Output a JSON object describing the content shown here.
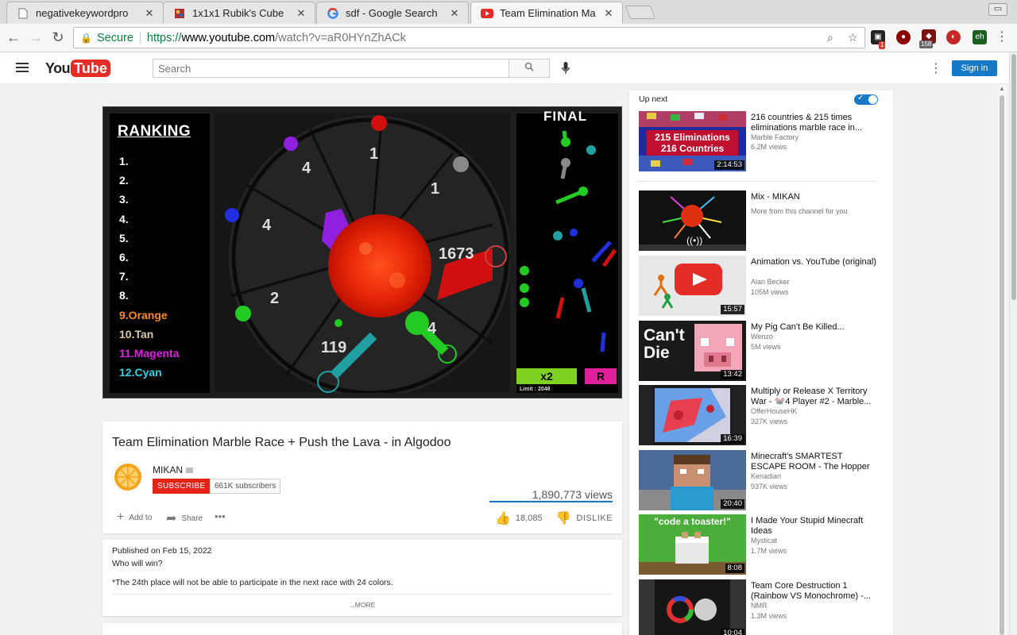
{
  "browser": {
    "tabs": [
      {
        "title": "negativekeywordpro",
        "favicon": "document-icon"
      },
      {
        "title": "1x1x1 Rubik's Cube",
        "favicon": "cube-icon"
      },
      {
        "title": "sdf - Google Search",
        "favicon": "google-icon"
      },
      {
        "title": "Team Elimination Ma",
        "favicon": "youtube-icon"
      }
    ],
    "address": {
      "secure_label": "Secure",
      "protocol": "https://",
      "host": "www.youtube.com",
      "path": "/watch?v=aR0HYnZhACk"
    },
    "extensions": {
      "badge_red": "1",
      "badge_count": "158"
    }
  },
  "youtube": {
    "logo_you": "You",
    "logo_tube": "Tube",
    "search_placeholder": "Search",
    "sign_in": "Sign in"
  },
  "video": {
    "overlay": {
      "ranking_title": "RANKING",
      "ranks": [
        "1.",
        "2.",
        "3.",
        "4.",
        "5.",
        "6.",
        "7.",
        "8.",
        "9.Orange",
        "10.Tan",
        "11.Magenta",
        "12.Cyan"
      ],
      "rank_colors": [
        "#ffffff",
        "#ffffff",
        "#ffffff",
        "#ffffff",
        "#ffffff",
        "#ffffff",
        "#ffffff",
        "#ffffff",
        "#ff8c1a",
        "#d9c8a8",
        "#e020e0",
        "#30d0e0"
      ],
      "arena_numbers": [
        "4",
        "1",
        "1",
        "4",
        "1673",
        "2",
        "119",
        "4"
      ],
      "final_title": "FINAL",
      "multiplier": "x2",
      "r_label": "R",
      "limit": "Limit : 2048"
    },
    "title": "Team Elimination Marble Race + Push the Lava - in Algodoo",
    "channel": "MIKAN",
    "subscribe": "SUBSCRIBE",
    "subscribers": "661K subscribers",
    "views": "1,890,773 views",
    "actions": {
      "add_to": "Add to",
      "share": "Share",
      "likes": "18,085",
      "dislike": "DISLIKE"
    },
    "description": {
      "published": "Published on Feb 15, 2022",
      "line1": "Who will win?",
      "line2": "*The 24th place will not be able to participate in the next race with 24 colors.",
      "more": "...MORE"
    }
  },
  "sidebar": {
    "up_next": "Up next",
    "items": [
      {
        "title": "216 countries & 215 times eliminations marble race in...",
        "channel": "Marble Factory",
        "views": "6.2M views",
        "duration": "2:14:53",
        "thumb_text": "215 Eliminations 216 Countries"
      },
      {
        "title": "Mix - MIKAN",
        "channel": "More from this channel for you",
        "views": "",
        "duration": "",
        "thumb_text": ""
      },
      {
        "title": "Animation vs. YouTube (original)",
        "channel": "Alan Becker",
        "views": "105M views",
        "duration": "15:57",
        "thumb_text": ""
      },
      {
        "title": "My Pig Can't Be Killed...",
        "channel": "Wenzo",
        "views": "5M views",
        "duration": "13:42",
        "thumb_text": "Can't Die"
      },
      {
        "title": "Multiply or Release X Territory War - 🐭4 Player #2 - Marble...",
        "channel": "OfferHouseHK",
        "views": "327K views",
        "duration": "16:39",
        "thumb_text": ""
      },
      {
        "title": "Minecraft's SMARTEST ESCAPE ROOM - The Hopper",
        "channel": "Kenadian",
        "views": "937K views",
        "duration": "20:40",
        "thumb_text": ""
      },
      {
        "title": "I Made Your Stupid Minecraft Ideas",
        "channel": "Mysticat",
        "views": "1.7M views",
        "duration": "8:08",
        "thumb_text": "\"code a toaster!\""
      },
      {
        "title": "Team Core Destruction 1 (Rainbow VS Monochrome) -...",
        "channel": "NMR",
        "views": "1.3M views",
        "duration": "10:04",
        "thumb_text": ""
      }
    ]
  }
}
